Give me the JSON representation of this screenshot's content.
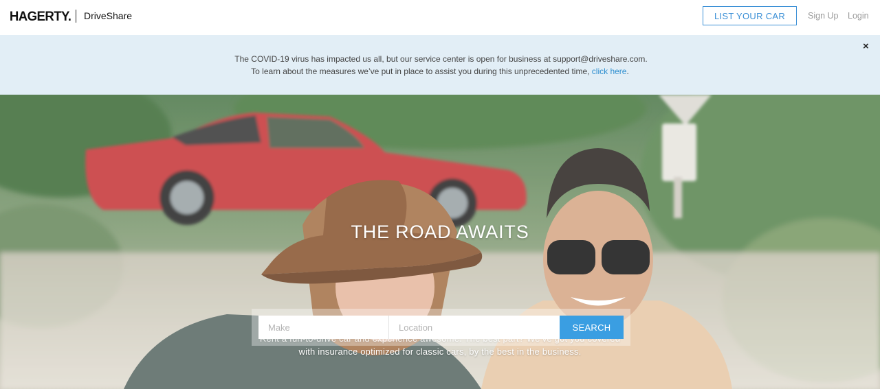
{
  "header": {
    "logo": "HAGERTY.",
    "brand": "DriveShare",
    "list_car": "LIST YOUR CAR",
    "sign_up": "Sign Up",
    "login": "Login"
  },
  "banner": {
    "line1": "The COVID-19 virus has impacted us all, but our service center is open for business at support@driveshare.com.",
    "line2_prefix": "To learn about the measures we’ve put in place to assist you during this unprecedented time, ",
    "line2_link": "click here",
    "line2_suffix": ".",
    "close": "×"
  },
  "hero": {
    "title": "THE ROAD AWAITS",
    "tagline_1": "Rent a fun-to-drive car and experience awesome. The best part? We’ve got you covered",
    "tagline_2": "with insurance optimized for classic cars, by the best in the business."
  },
  "search": {
    "make_placeholder": "Make",
    "location_placeholder": "Location",
    "button": "SEARCH"
  },
  "colors": {
    "accent": "#3a9ee2",
    "banner_bg": "#e2eef6",
    "link": "#2f8fd0"
  }
}
